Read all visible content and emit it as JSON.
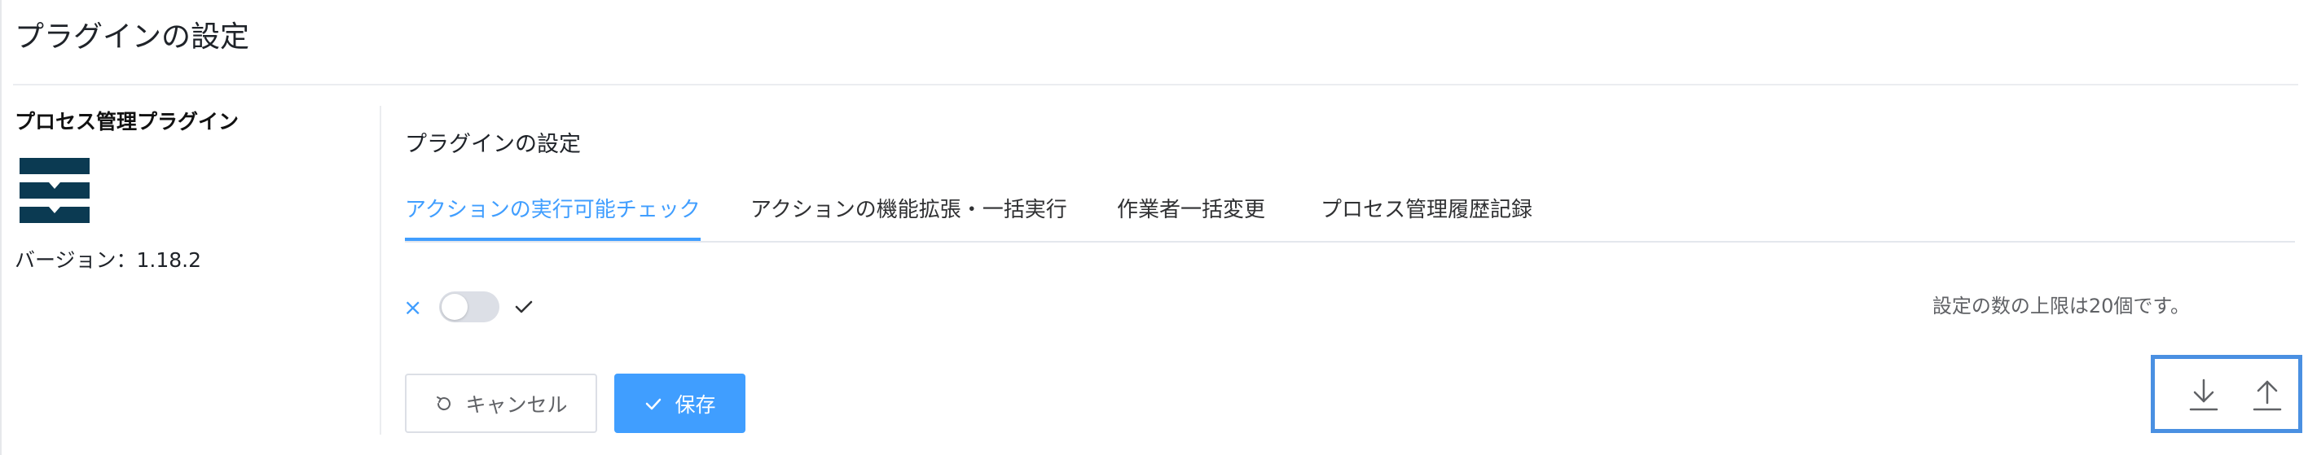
{
  "page": {
    "title": "プラグインの設定"
  },
  "plugin": {
    "name": "プロセス管理プラグイン",
    "version_label": "バージョン：1.18.2",
    "logo_icon": "stacked-layers-logo",
    "logo_color": "#0b3a52"
  },
  "panel": {
    "title": "プラグインの設定",
    "tabs": [
      {
        "label": "アクションの実行可能チェック",
        "active": true
      },
      {
        "label": "アクションの機能拡張・一括実行",
        "active": false
      },
      {
        "label": "作業者一括変更",
        "active": false
      },
      {
        "label": "プロセス管理履歴記録",
        "active": false
      }
    ],
    "toggle": {
      "off_symbol": "×",
      "on_icon": "check-icon",
      "state": "off"
    },
    "limit_note": "設定の数の上限は20個です。"
  },
  "buttons": {
    "cancel_label": "キャンセル",
    "cancel_icon": "refresh-icon",
    "save_label": "保存",
    "save_icon": "check-icon"
  },
  "io": {
    "download_icon": "download-icon",
    "upload_icon": "upload-icon",
    "highlight_color": "#4a90e2"
  },
  "colors": {
    "accent": "#409eff",
    "text": "#1f2329",
    "muted": "#606266"
  }
}
